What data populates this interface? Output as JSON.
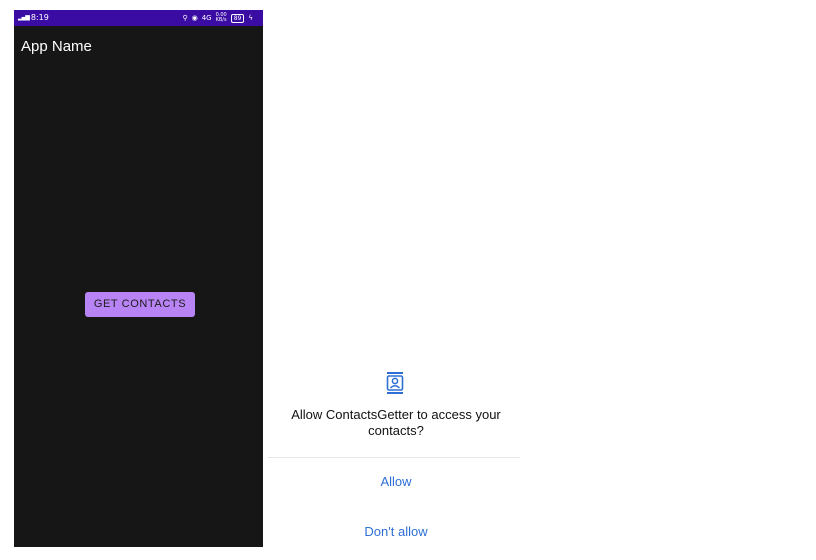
{
  "status_bar": {
    "time": "8:19",
    "signal_text": "4G",
    "battery": "89",
    "data_speed": "0.00\nKB/s"
  },
  "app": {
    "title": "App Name",
    "get_contacts_label": "GET CONTACTS",
    "button_color": "#b884f5",
    "status_bar_color": "#3a0ca3",
    "background_color": "#161616"
  },
  "dialog": {
    "icon": "contacts-icon",
    "message_line1": "Allow ContactsGetter to access your",
    "message_line2": "contacts?",
    "allow_label": "Allow",
    "deny_label": "Don't allow",
    "accent_color": "#2e6fd6"
  }
}
